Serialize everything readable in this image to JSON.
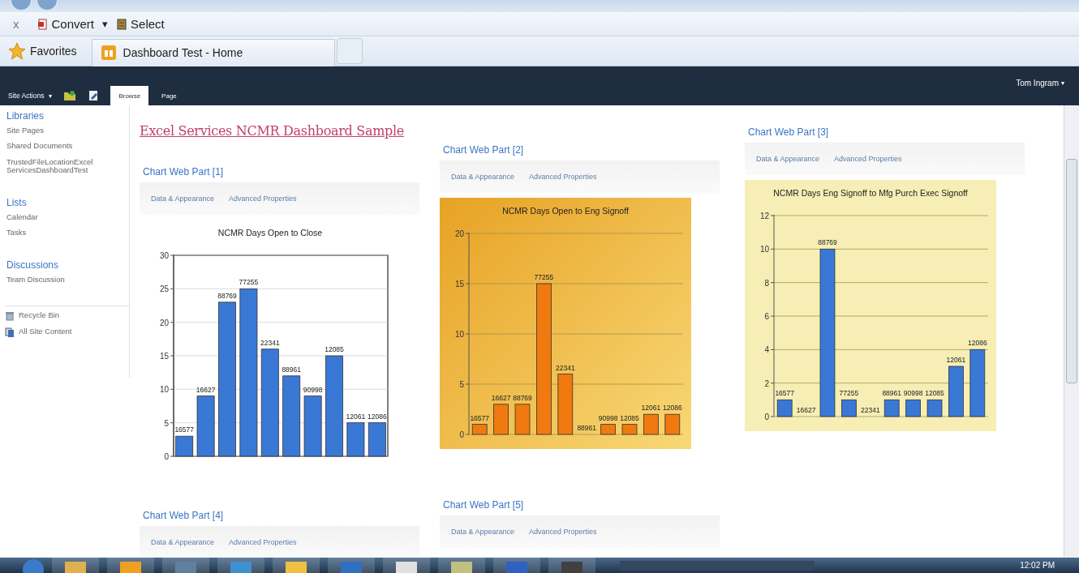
{
  "command_bar": {
    "close": "x",
    "items": [
      {
        "label": "Convert",
        "caret": "▾",
        "kind": "convert"
      },
      {
        "label": "Select",
        "kind": "select"
      }
    ]
  },
  "favorites_bar": {
    "favorites": "Favorites",
    "tabs": [
      {
        "label": "Dashboard Test - Home",
        "selected": true
      }
    ]
  },
  "ribbon": {
    "site_actions": "Site Actions",
    "site_actions_caret": "▾",
    "tabs": [
      {
        "label": "Browse",
        "selected": true
      },
      {
        "label": "Page",
        "selected": false
      }
    ],
    "user": "Tom Ingram",
    "user_caret": "▾"
  },
  "sidebar": {
    "sections": [
      {
        "heading": "Libraries",
        "items": [
          "Site Pages",
          "Shared Documents",
          "TrustedFileLocationExcel ServicesDashboardTest"
        ]
      },
      {
        "heading": "Lists",
        "items": [
          "Calendar",
          "Tasks"
        ]
      },
      {
        "heading": "Discussions",
        "items": [
          "Team Discussion"
        ]
      }
    ],
    "footer_items": [
      {
        "label": "Recycle Bin",
        "kind": "recycle"
      },
      {
        "label": "All Site Content",
        "kind": "content"
      }
    ]
  },
  "page": {
    "title": "Excel Services NCMR Dashboard Sample",
    "columns": [
      [
        {
          "title": "Chart Web Part [1]",
          "links": [
            "Data & Appearance",
            "Advanced Properties"
          ],
          "kind": "plain",
          "chart_data": {
            "type": "bar",
            "title": "NCMR Days Open to Close",
            "grid": true,
            "series": [
              {
                "color": "#3a78d6",
                "values": [
                  3,
                  9,
                  23,
                  25,
                  16,
                  12,
                  9,
                  15,
                  5,
                  5
                ]
              }
            ],
            "ylim": [
              0,
              30
            ],
            "yticks": [
              0,
              5,
              10,
              15,
              20,
              25,
              30
            ],
            "value_labels": [
              "16577",
              "16627",
              "88769",
              "77255",
              "22341",
              "88961",
              "90998",
              "12085",
              "12061",
              "12086"
            ]
          }
        },
        {
          "title": "Chart Web Part [4]",
          "links": [
            "Data & Appearance",
            "Advanced Properties"
          ]
        }
      ],
      [
        {
          "title": "Chart Web Part [2]",
          "links": [
            "Data & Appearance",
            "Advanced Properties"
          ],
          "kind": "orange",
          "chart_data": {
            "type": "bar",
            "title": "NCMR Days Open to Eng Signoff",
            "grid": true,
            "series": [
              {
                "color": "#f07a10",
                "values": [
                  1,
                  3,
                  3,
                  15,
                  6,
                  0,
                  1,
                  1,
                  2,
                  2
                ]
              }
            ],
            "ylim": [
              0,
              20
            ],
            "yticks": [
              0,
              5,
              10,
              15,
              20
            ],
            "value_labels": [
              "16577",
              "16627",
              "88769",
              "77255",
              "22341",
              "88961",
              "90998",
              "12085",
              "12061",
              "12086"
            ]
          }
        },
        {
          "title": "Chart Web Part [5]",
          "links": [
            "Data & Appearance",
            "Advanced Properties"
          ]
        }
      ],
      [
        {
          "title": "Chart Web Part [3]",
          "links": [
            "Data & Appearance",
            "Advanced Properties"
          ],
          "kind": "beige",
          "chart_data": {
            "type": "bar",
            "title": "NCMR Days Eng Signoff to Mfg Purch Exec Signoff",
            "grid": true,
            "series": [
              {
                "color": "#3a78d6",
                "values": [
                  1,
                  0,
                  10,
                  1,
                  0,
                  1,
                  1,
                  1,
                  3,
                  4
                ]
              }
            ],
            "ylim": [
              0,
              12
            ],
            "yticks": [
              0,
              2,
              4,
              6,
              8,
              10,
              12
            ],
            "value_labels": [
              "16577",
              "16627",
              "88769",
              "77255",
              "22341",
              "88961",
              "90998",
              "12085",
              "12061",
              "12086"
            ]
          }
        }
      ]
    ]
  },
  "taskbar": {
    "clock": "12:02 PM"
  }
}
